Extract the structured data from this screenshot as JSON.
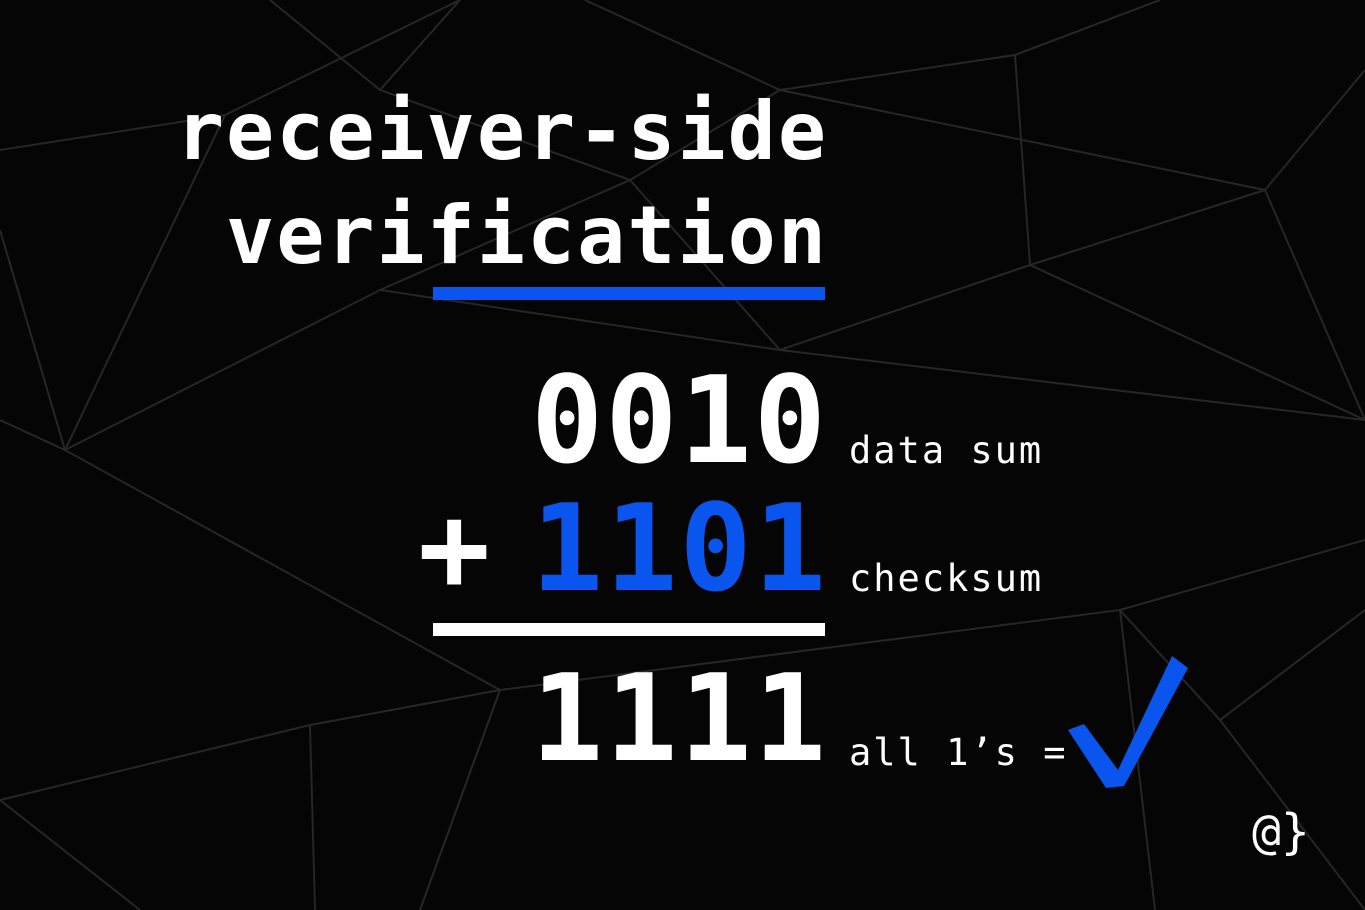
{
  "title": {
    "line1": "receiver-side",
    "line2": "verification"
  },
  "calculation": {
    "operand1": "0010",
    "operand1_label": "data sum",
    "operator": "+",
    "operand2": "1101",
    "operand2_label": "checksum",
    "result": "1111",
    "result_label": "all 1’s ="
  },
  "icons": {
    "result_mark": "checkmark-icon"
  },
  "logo_text": "@}",
  "colors": {
    "background": "#050505",
    "accent": "#0a55ee",
    "text": "#ffffff",
    "mesh_lines": "#262626"
  }
}
